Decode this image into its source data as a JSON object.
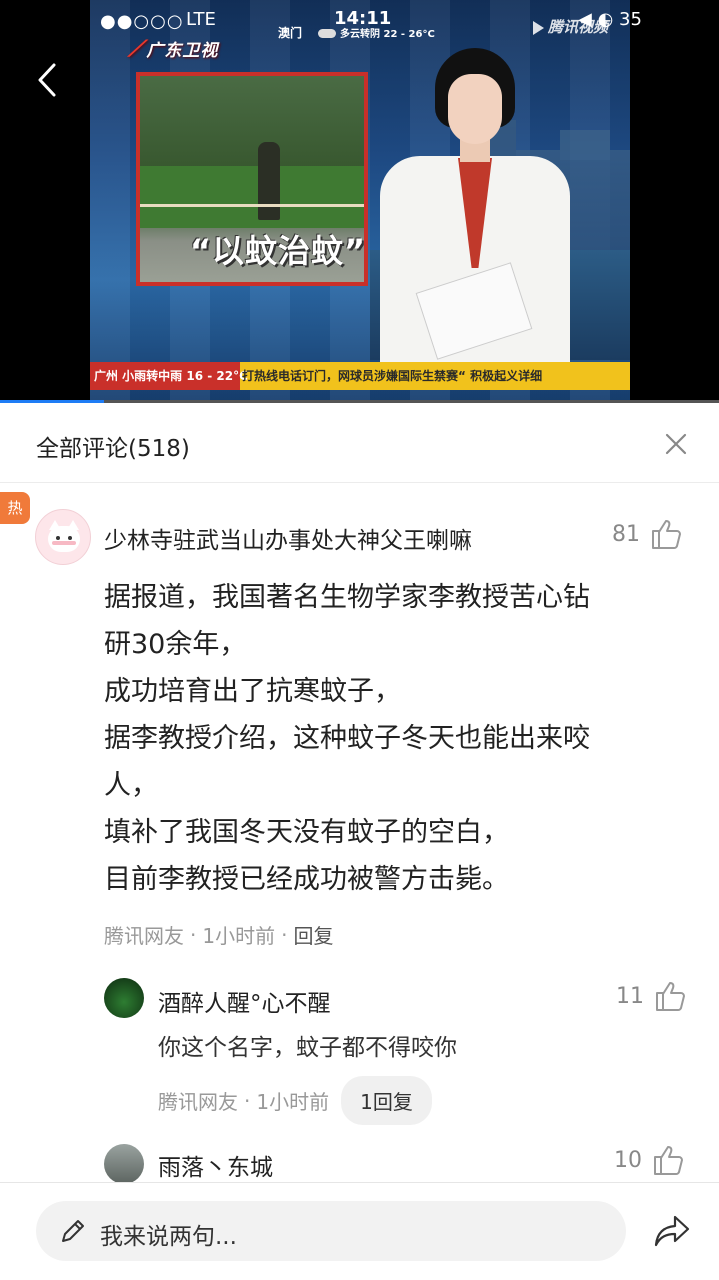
{
  "status_bar": {
    "signal": "●●○○○",
    "network": "LTE",
    "time": "14:11",
    "battery": "◀ ◐ 35"
  },
  "video": {
    "channel_logo": "广东卫视",
    "weather_city": "澳门",
    "weather_forecast": "多云转阴 22 - 26°C",
    "watermark": "腾讯视频",
    "inset_caption": "“以蚊治蚊”",
    "ticker_city": "广州 小雨转中雨 16 - 22°C",
    "ticker_news": "打热线电话订门，网球员涉嫌国际生禁赛“ 积极起义详细",
    "progress_fraction": 0.145,
    "progress_color": "#1e7cf5"
  },
  "comments_panel": {
    "title": "全部评论(518)",
    "hot_badge": "热",
    "main_comment": {
      "username": "少林寺驻武当山办事处大神父王喇嘛",
      "likes": "81",
      "lines": [
        "据报道，我国著名生物学家李教授苦心钻",
        "研30余年，",
        "成功培育出了抗寒蚊子，",
        "据李教授介绍，这种蚊子冬天也能出来咬",
        "人，",
        "填补了我国冬天没有蚊子的空白，",
        "目前李教授已经成功被警方击毙。"
      ],
      "source": "腾讯网友",
      "time": "1小时前",
      "reply_label": "回复"
    },
    "replies": [
      {
        "username": "酒醉人醒°心不醒",
        "likes": "11",
        "text": "你这个名字，蚊子都不得咬你",
        "source": "腾讯网友",
        "time": "1小时前",
        "reply_count": "1回复"
      },
      {
        "username": "雨落丶东城",
        "likes": "10"
      }
    ]
  },
  "bottom_bar": {
    "input_placeholder": "我来说两句..."
  },
  "icons": {
    "back": "back-arrow-icon",
    "close": "close-icon",
    "like": "thumbs-up-icon",
    "pencil": "pencil-icon",
    "share": "share-icon"
  },
  "colors": {
    "hot_badge": "#f07a3a",
    "accent_blue": "#1e7cf5"
  }
}
